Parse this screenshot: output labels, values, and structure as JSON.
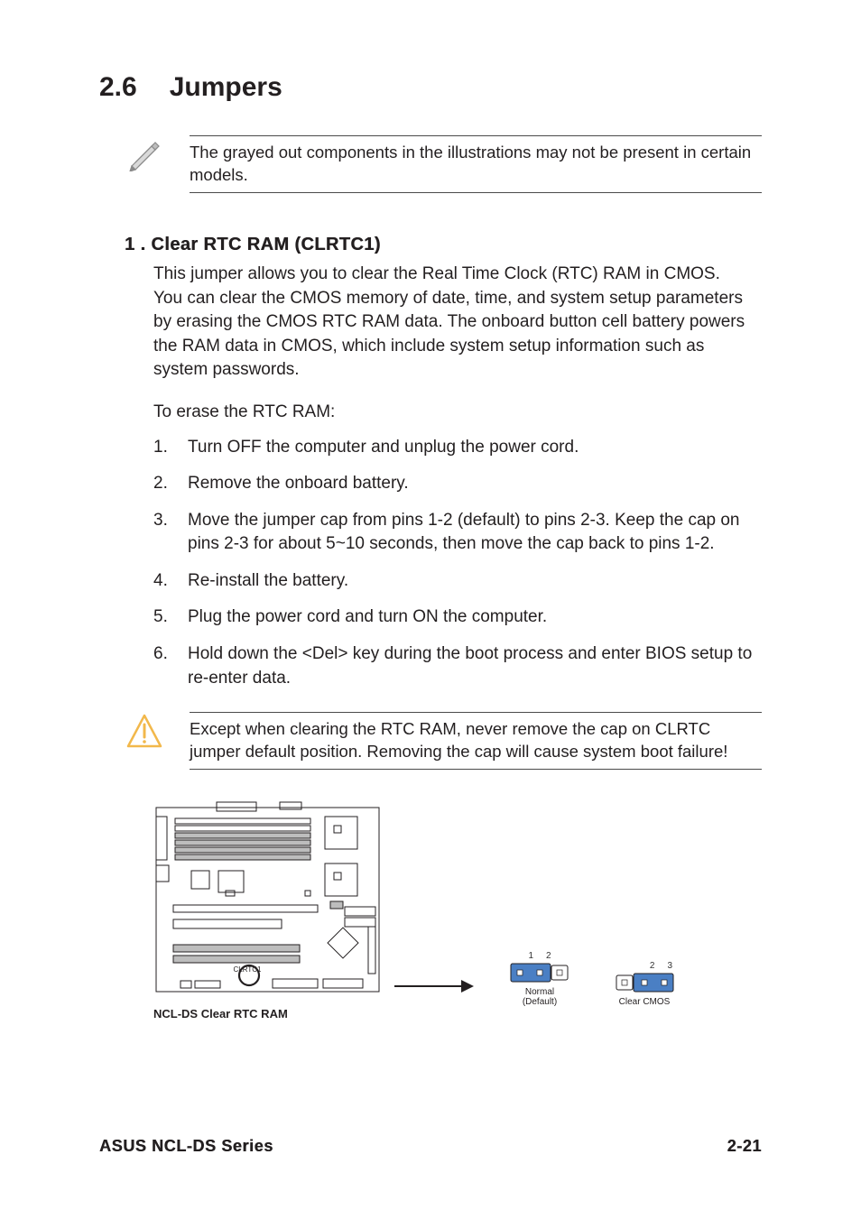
{
  "heading": {
    "number": "2.6",
    "title": "Jumpers"
  },
  "note": {
    "text": "The grayed out components in the illustrations may not be present in certain models."
  },
  "sub": {
    "number": "1 .",
    "title": "Clear RTC RAM (CLRTC1)",
    "para": "This jumper allows you to clear the  Real Time Clock (RTC) RAM in CMOS. You can clear the CMOS memory of date, time, and system setup parameters by erasing the CMOS RTC RAM data. The onboard button cell battery powers the RAM data in CMOS, which include system setup information such as system passwords.",
    "lead": "To erase the RTC RAM:",
    "steps": [
      "Turn OFF the computer and unplug the power cord.",
      "Remove the onboard battery.",
      "Move the jumper cap from pins 1-2 (default) to pins 2-3. Keep the cap on pins 2-3 for about 5~10 seconds, then move the cap back to pins  1-2.",
      "Re-install the battery.",
      "Plug the power cord and turn ON the computer.",
      "Hold down the <Del> key during the boot process and enter BIOS setup to re-enter data."
    ]
  },
  "caution": {
    "text": "Except when clearing the RTC RAM, never remove the cap on CLRTC jumper default position. Removing the cap will cause system boot failure!"
  },
  "diagram": {
    "clrtc_label": "CLRTC1",
    "caption": "NCL-DS Clear RTC RAM",
    "pos_a": {
      "pins": "1 2",
      "state": "Normal\n(Default)"
    },
    "pos_b": {
      "pins": "2 3",
      "state": "Clear CMOS"
    }
  },
  "footer": {
    "left": "ASUS NCL-DS Series",
    "right": "2-21"
  }
}
